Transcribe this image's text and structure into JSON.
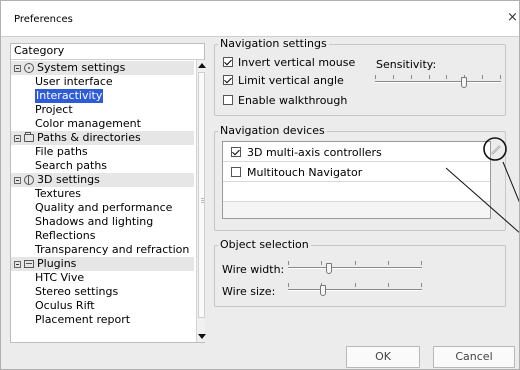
{
  "window": {
    "title": "Preferences",
    "close_glyph": "×"
  },
  "category": {
    "header": "Category",
    "items": [
      {
        "label": "System settings",
        "kind": "group",
        "icon": "gear-icon"
      },
      {
        "label": "User interface",
        "kind": "child"
      },
      {
        "label": "Interactivity",
        "kind": "child",
        "selected": true
      },
      {
        "label": "Project",
        "kind": "child"
      },
      {
        "label": "Color management",
        "kind": "child"
      },
      {
        "label": "Paths & directories",
        "kind": "group",
        "icon": "folder-icon"
      },
      {
        "label": "File paths",
        "kind": "child"
      },
      {
        "label": "Search paths",
        "kind": "child"
      },
      {
        "label": "3D settings",
        "kind": "group",
        "icon": "globe-icon"
      },
      {
        "label": "Textures",
        "kind": "child"
      },
      {
        "label": "Quality and performance",
        "kind": "child"
      },
      {
        "label": "Shadows and lighting",
        "kind": "child"
      },
      {
        "label": "Reflections",
        "kind": "child"
      },
      {
        "label": "Transparency and refraction",
        "kind": "child"
      },
      {
        "label": "Plugins",
        "kind": "group",
        "icon": "plugin-icon"
      },
      {
        "label": "HTC Vive",
        "kind": "child"
      },
      {
        "label": "Stereo settings",
        "kind": "child"
      },
      {
        "label": "Oculus Rift",
        "kind": "child"
      },
      {
        "label": "Placement report",
        "kind": "child"
      }
    ]
  },
  "navigation_settings": {
    "title": "Navigation settings",
    "invert_mouse": {
      "label": "Invert vertical mouse",
      "checked": true
    },
    "limit_angle": {
      "label": "Limit vertical angle",
      "checked": true
    },
    "walkthrough": {
      "label": "Enable walkthrough",
      "checked": false
    },
    "sensitivity_label": "Sensitivity:",
    "sensitivity_level": 0.72
  },
  "navigation_devices": {
    "title": "Navigation devices",
    "items": [
      {
        "label": "3D multi-axis controllers",
        "checked": true
      },
      {
        "label": "Multitouch Navigator",
        "checked": false
      }
    ],
    "edit_icon": "pencil-icon"
  },
  "object_selection": {
    "title": "Object selection",
    "wire_width_label": "Wire width:",
    "wire_width_level": 0.3,
    "wire_size_label": "Wire size:",
    "wire_size_level": 0.25
  },
  "buttons": {
    "ok": "OK",
    "cancel": "Cancel"
  }
}
